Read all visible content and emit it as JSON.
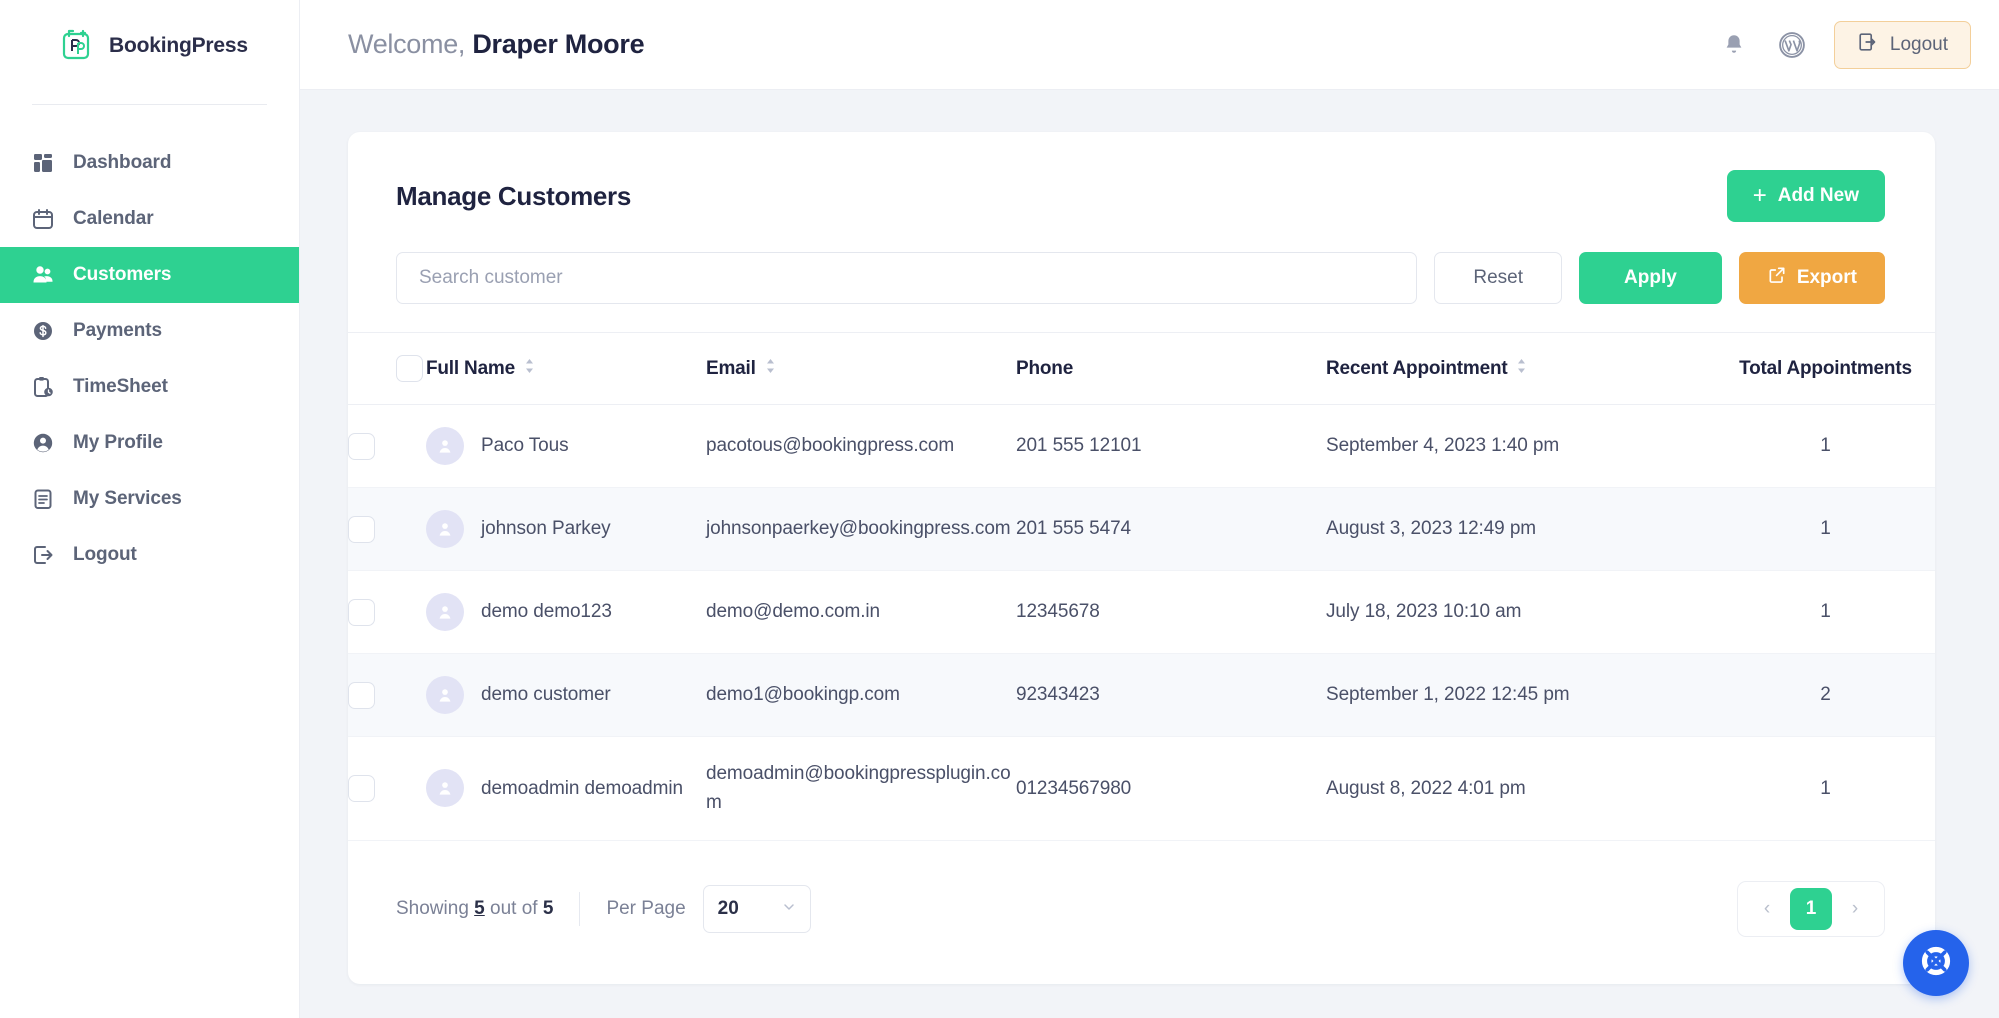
{
  "brand": {
    "name": "BookingPress",
    "logo_icon": "bookingpress-logo-icon",
    "accent": "#2ed191"
  },
  "sidebar": {
    "items": [
      {
        "label": "Dashboard",
        "icon": "dashboard-grid-icon",
        "active": false
      },
      {
        "label": "Calendar",
        "icon": "calendar-icon",
        "active": false
      },
      {
        "label": "Customers",
        "icon": "users-icon",
        "active": true
      },
      {
        "label": "Payments",
        "icon": "dollar-circle-icon",
        "active": false
      },
      {
        "label": "TimeSheet",
        "icon": "clipboard-clock-icon",
        "active": false
      },
      {
        "label": "My Profile",
        "icon": "user-circle-icon",
        "active": false
      },
      {
        "label": "My Services",
        "icon": "clipboard-list-icon",
        "active": false
      },
      {
        "label": "Logout",
        "icon": "logout-arrow-icon",
        "active": false
      }
    ]
  },
  "topbar": {
    "welcome_prefix": "Welcome,",
    "user_name": "Draper Moore",
    "bell_icon": "notification-bell-icon",
    "wordpress_icon": "wordpress-icon",
    "logout_label": "Logout",
    "logout_icon": "logout-arrow-icon"
  },
  "page": {
    "title": "Manage Customers",
    "add_new_label": "Add New",
    "add_new_icon": "plus-icon"
  },
  "filters": {
    "search_placeholder": "Search customer",
    "search_value": "",
    "reset_label": "Reset",
    "apply_label": "Apply",
    "export_label": "Export",
    "export_icon": "external-link-icon"
  },
  "table": {
    "columns": [
      {
        "label": "Full Name",
        "sortable": true
      },
      {
        "label": "Email",
        "sortable": true
      },
      {
        "label": "Phone",
        "sortable": false
      },
      {
        "label": "Recent Appointment",
        "sortable": true
      },
      {
        "label": "Total Appointments",
        "sortable": false
      }
    ],
    "rows": [
      {
        "name": "Paco Tous",
        "email": "pacotous@bookingpress.com",
        "phone": "201 555 12101",
        "recent": "September 4, 2023 1:40 pm",
        "total": "1"
      },
      {
        "name": "johnson Parkey",
        "email": "johnsonpaerkey@bookingpress.com",
        "phone": "201 555 5474",
        "recent": "August 3, 2023 12:49 pm",
        "total": "1"
      },
      {
        "name": "demo demo123",
        "email": "demo@demo.com.in",
        "phone": "12345678",
        "recent": "July 18, 2023 10:10 am",
        "total": "1"
      },
      {
        "name": "demo customer",
        "email": "demo1@bookingp.com",
        "phone": "92343423",
        "recent": "September 1, 2022 12:45 pm",
        "total": "2"
      },
      {
        "name": "demoadmin demoadmin",
        "email": "demoadmin@bookingpressplugin.com",
        "phone": "01234567980",
        "recent": "August 8, 2022 4:01 pm",
        "total": "1"
      }
    ]
  },
  "footer": {
    "showing_prefix": "Showing",
    "showing_count": "5",
    "showing_middle": "out of",
    "showing_total": "5",
    "per_page_label": "Per Page",
    "per_page_value": "20",
    "prev_label": "‹",
    "next_label": "›",
    "current_page": "1"
  },
  "fab": {
    "icon": "lifebuoy-help-icon",
    "color": "#2563eb"
  }
}
